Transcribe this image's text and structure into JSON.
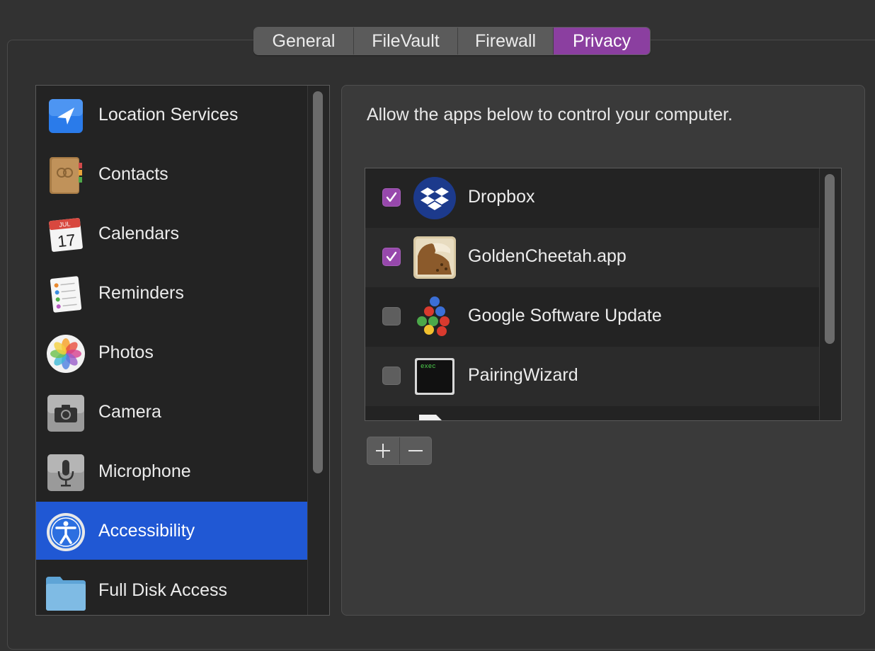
{
  "tabs": [
    "General",
    "FileVault",
    "Firewall",
    "Privacy"
  ],
  "active_tab": "Privacy",
  "categories": [
    {
      "label": "Location Services",
      "icon": "location-arrow-icon"
    },
    {
      "label": "Contacts",
      "icon": "contacts-book-icon"
    },
    {
      "label": "Calendars",
      "icon": "calendar-icon",
      "month": "JUL",
      "day": "17"
    },
    {
      "label": "Reminders",
      "icon": "reminders-list-icon"
    },
    {
      "label": "Photos",
      "icon": "photos-flower-icon"
    },
    {
      "label": "Camera",
      "icon": "camera-icon"
    },
    {
      "label": "Microphone",
      "icon": "microphone-icon"
    },
    {
      "label": "Accessibility",
      "icon": "accessibility-figure-icon"
    },
    {
      "label": "Full Disk Access",
      "icon": "folder-icon"
    }
  ],
  "selected_category": "Accessibility",
  "description": "Allow the apps below to control your computer.",
  "apps": [
    {
      "name": "Dropbox",
      "checked": true,
      "icon": "dropbox-icon"
    },
    {
      "name": "GoldenCheetah.app",
      "checked": true,
      "icon": "goldencheetah-icon"
    },
    {
      "name": "Google Software Update",
      "checked": false,
      "icon": "google-update-balls-icon"
    },
    {
      "name": "PairingWizard",
      "checked": false,
      "icon": "terminal-exec-icon",
      "icon_text": "exec"
    }
  ],
  "buttons": {
    "add": "+",
    "remove": "−"
  },
  "colors": {
    "accent": "#8b3fa0",
    "selection": "#2058d4"
  }
}
